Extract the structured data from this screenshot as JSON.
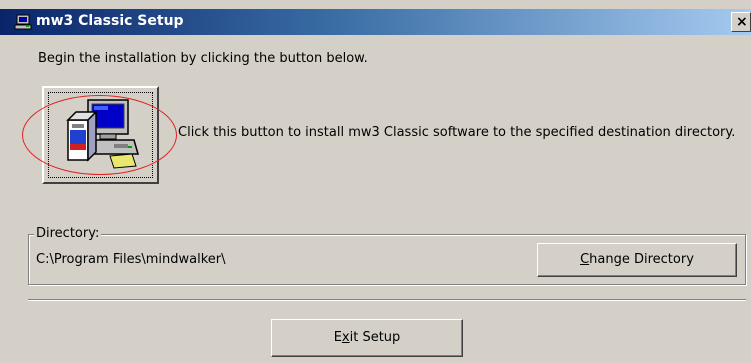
{
  "window": {
    "title": "mw3 Classic Setup",
    "close_glyph": "×",
    "title_icon": "setup-computer-icon",
    "close_icon": "close-icon"
  },
  "main": {
    "instruction": "Begin the installation by clicking the button below.",
    "install_button_icon": "installer-computer-icon",
    "install_description": "Click this button to install mw3 Classic software to the specified destination directory."
  },
  "directory": {
    "group_label": "Directory:",
    "path": "C:\\Program Files\\mindwalker\\",
    "change_button": {
      "mnemonic": "C",
      "rest": "hange Directory"
    }
  },
  "footer": {
    "exit_button": {
      "before": "E",
      "mnemonic": "x",
      "after": "it Setup"
    }
  },
  "colors": {
    "dialog_bg": "#d4d0c8",
    "title_gradient_start": "#0a246a",
    "title_gradient_end": "#a6caf0",
    "annotation": "#e02020"
  }
}
